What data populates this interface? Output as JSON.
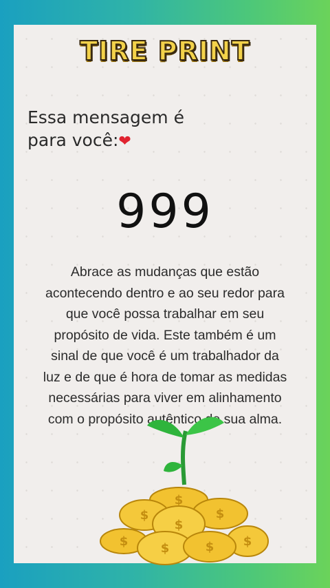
{
  "brand": "TIRE PRINT",
  "intro_line1": "Essa mensagem é",
  "intro_line2": "para você:",
  "heart_icon": "red-heart-emoji",
  "number": "999",
  "message": "Abrace as mudanças que estão acontecendo dentro e ao seu redor para que você possa trabalhar em seu propósito de vida. Este também é um sinal de que você é um trabalhador da luz e de que é hora de tomar as medidas necessárias para viver em alinhamento com o propósito autêntico de sua alma.",
  "colors": {
    "brand_fill": "#f3d24a",
    "heart": "#e0232f",
    "card": "#f1eeec",
    "sprout": "#2fb43c",
    "coin": "#f2c230"
  }
}
